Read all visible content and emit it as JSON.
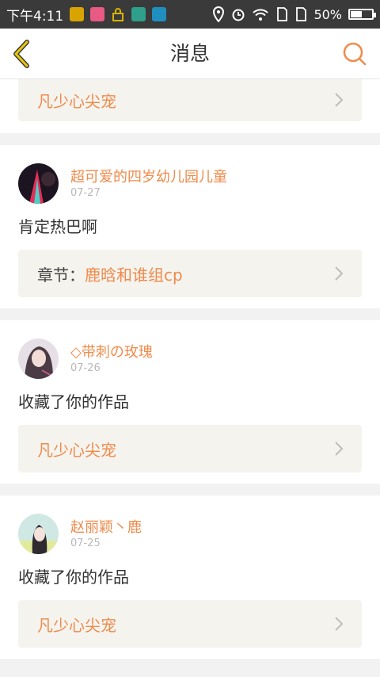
{
  "status_bar": {
    "time": "下午4:11",
    "battery": "50%",
    "app_colors": [
      "#d9a300",
      "#e85a84",
      "#2ea08b",
      "#1f8fbf"
    ]
  },
  "nav": {
    "back_icon": "back-chevron-icon",
    "title": "消息",
    "search_icon": "search-icon",
    "accent": "#f08b4b"
  },
  "notifications": {
    "top_partial": {
      "ref_title": "凡少心尖宠"
    },
    "items": [
      {
        "user": "超可爱的四岁幼儿园儿童",
        "date": "07-27",
        "text": "肯定热巴啊",
        "ref_prefix": "章节：",
        "ref_title": "鹿晗和谁组cp"
      },
      {
        "user": "◇带刺の玫瑰",
        "date": "07-26",
        "text": "收藏了你的作品",
        "ref_prefix": "",
        "ref_title": "凡少心尖宠"
      },
      {
        "user": "赵丽颖丶鹿",
        "date": "07-25",
        "text": "收藏了你的作品",
        "ref_prefix": "",
        "ref_title": "凡少心尖宠"
      }
    ]
  }
}
